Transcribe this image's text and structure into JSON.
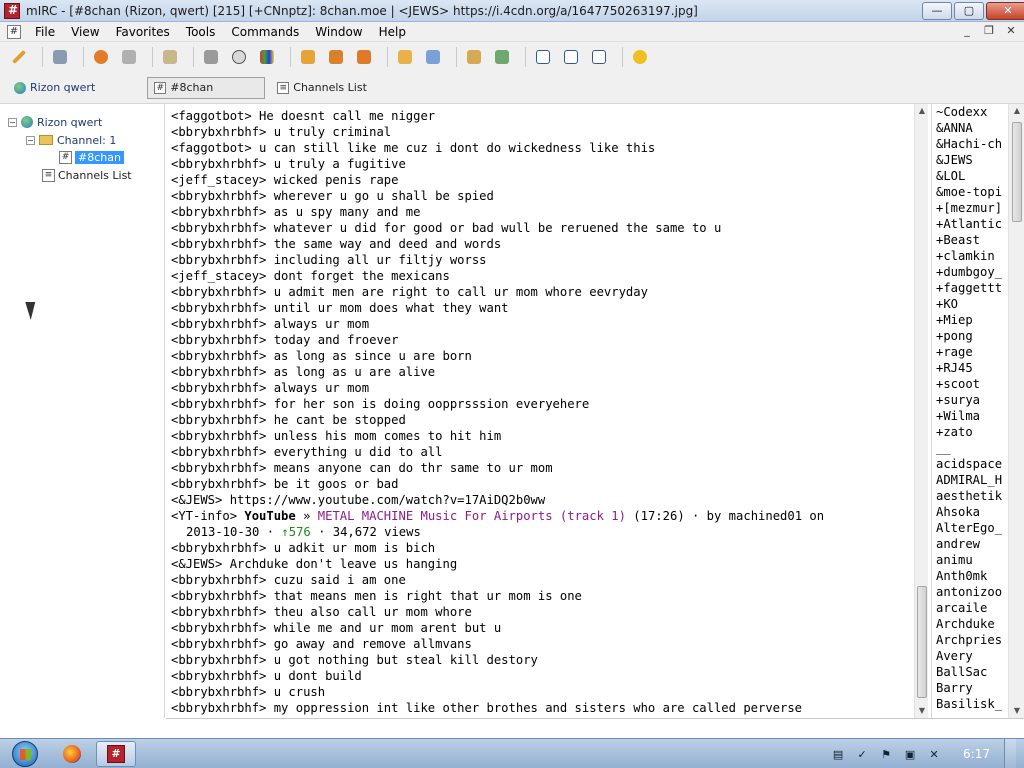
{
  "window": {
    "title": "mIRC - [#8chan (Rizon, qwert) [215] [+CNnptz]: 8chan.moe | <JEWS> https://i.4cdn.org/a/1647750263197.jpg]",
    "minimize": "—",
    "maximize": "▢",
    "close": "✕"
  },
  "menu": {
    "items": [
      "File",
      "View",
      "Favorites",
      "Tools",
      "Commands",
      "Window",
      "Help"
    ]
  },
  "mdi": {
    "minimize": "_",
    "restore": "❐",
    "close": "✕"
  },
  "switchbar": {
    "server": "Rizon qwert",
    "channel": "#8chan",
    "channels_list": "Channels List"
  },
  "tree": {
    "server": "Rizon qwert",
    "folder": "Channel: 1",
    "channel": "#8chan",
    "channels_list": "Channels List"
  },
  "chat": {
    "lines": [
      "<faggotbot> He doesnt call me nigger",
      "<bbrybxhrbhf> u truly criminal",
      "<faggotbot> u can still like me cuz i dont do wickedness like this",
      "<bbrybxhrbhf> u truly a fugitive",
      "<jeff_stacey> wicked penis rape",
      "<bbrybxhrbhf> wherever u go u shall be spied",
      "<bbrybxhrbhf> as u spy many and me",
      "<bbrybxhrbhf> whatever u did for good or bad wull be reruened the same to u",
      "<bbrybxhrbhf> the same way and deed and words",
      "<bbrybxhrbhf> including all ur filtjy worss",
      "<jeff_stacey> dont forget the mexicans",
      "<bbrybxhrbhf> u admit men are right to call ur mom whore eevryday",
      "<bbrybxhrbhf> until ur mom does what they want",
      "<bbrybxhrbhf> always ur mom",
      "<bbrybxhrbhf> today and froever",
      "<bbrybxhrbhf> as long as since u are born",
      "<bbrybxhrbhf> as long as u are alive",
      "<bbrybxhrbhf> always ur mom",
      "<bbrybxhrbhf> for her son is doing oopprsssion everyehere",
      "<bbrybxhrbhf> he cant be stopped",
      "<bbrybxhrbhf> unless his mom comes to hit him",
      "<bbrybxhrbhf> everything u did to all",
      "<bbrybxhrbhf> means anyone can do thr same to ur mom",
      "<bbrybxhrbhf> be it goos or bad",
      "<&JEWS> https://www.youtube.com/watch?v=17AiDQ2b0ww"
    ],
    "yt": {
      "prefix": "<YT-info> ",
      "brand": "YouTube",
      "sep": " » ",
      "title": "METAL MACHINE Music For Airports (track 1)",
      "meta": " (17:26) · by machined01 on",
      "date": "2013-10-30 · ",
      "likes": "↑576",
      "views": " · 34,672 views"
    },
    "lines2": [
      "<bbrybxhrbhf> u adkit ur mom is bich",
      "<&JEWS> Archduke don't leave us hanging",
      "<bbrybxhrbhf> cuzu said i am one",
      "<bbrybxhrbhf> that means men is right that ur mom is one",
      "<bbrybxhrbhf> theu also call ur mom whore",
      "<bbrybxhrbhf> while me and ur mom arent but u",
      "<bbrybxhrbhf> go away and remove allmvans",
      "<bbrybxhrbhf> u got nothing but steal kill destory",
      "<bbrybxhrbhf> u dont build",
      "<bbrybxhrbhf> u crush",
      "<bbrybxhrbhf> my oppression int like other brothes and sisters who are called perverse"
    ]
  },
  "nicks": [
    "~Codexx",
    "&ANNA",
    "&Hachi-ch",
    "&JEWS",
    "&LOL",
    "&moe-topi",
    "+[mezmur]",
    "+Atlantic",
    "+Beast",
    "+clamkin",
    "+dumbgoy_",
    "+faggettt",
    "+KO",
    "+Miep",
    "+pong",
    "+rage",
    "+RJ45",
    "+scoot",
    "+surya",
    "+Wilma",
    "+zato",
    "__",
    "acidspace",
    "ADMIRAL_H",
    "aesthetik",
    "Ahsoka",
    "AlterEgo_",
    "andrew",
    "animu",
    "Anth0mk",
    "antonizoo",
    "arcaile",
    "Archduke",
    "Archpries",
    "Avery",
    "BallSac",
    "Barry",
    "Basilisk_"
  ],
  "taskbar": {
    "clock": "6:17",
    "mirc_label": "#"
  },
  "colors": {
    "selection": "#3399ff",
    "yt_title": "#8b1d8b",
    "yt_likes": "#1e8a1e"
  }
}
